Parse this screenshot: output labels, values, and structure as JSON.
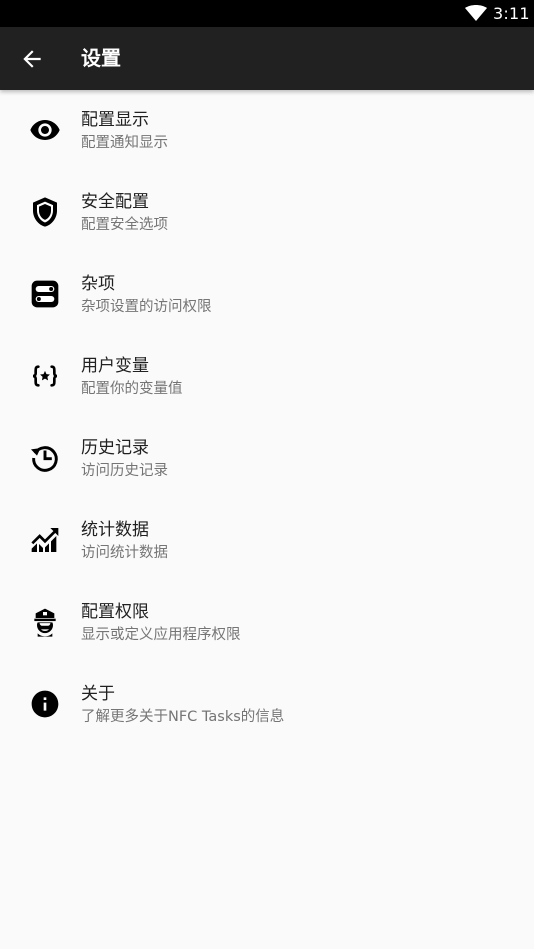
{
  "status_bar": {
    "time": "3:11",
    "wifi_icon": "wifi-icon"
  },
  "toolbar": {
    "back_icon": "arrow-back-icon",
    "title": "设置"
  },
  "colors": {
    "status_bar": "#000000",
    "toolbar": "#212121",
    "background": "#fafafa",
    "primary_text": "#212121",
    "secondary_text": "#757575"
  },
  "settings": [
    {
      "icon": "eye-icon",
      "title": "配置显示",
      "subtitle": "配置通知显示"
    },
    {
      "icon": "shield-icon",
      "title": "安全配置",
      "subtitle": "配置安全选项"
    },
    {
      "icon": "toggles-icon",
      "title": "杂项",
      "subtitle": "杂项设置的访问权限"
    },
    {
      "icon": "variable-icon",
      "title": "用户变量",
      "subtitle": "配置你的变量值"
    },
    {
      "icon": "history-icon",
      "title": "历史记录",
      "subtitle": "访问历史记录"
    },
    {
      "icon": "stats-icon",
      "title": "统计数据",
      "subtitle": "访问统计数据"
    },
    {
      "icon": "police-officer-icon",
      "title": "配置权限",
      "subtitle": "显示或定义应用程序权限"
    },
    {
      "icon": "info-icon",
      "title": "关于",
      "subtitle": "了解更多关于NFC Tasks的信息"
    }
  ]
}
